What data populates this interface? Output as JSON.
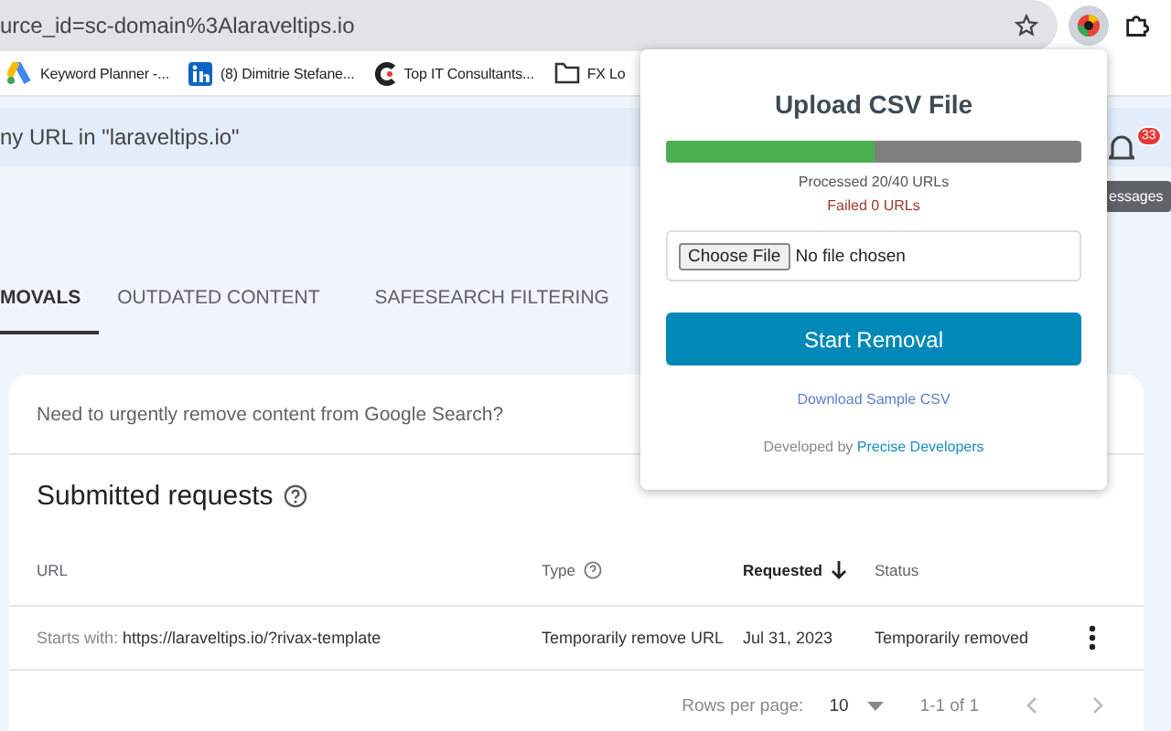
{
  "browser": {
    "address": "urce_id=sc-domain%3Alaraveltips.io",
    "bookmarks": [
      {
        "kind": "ads",
        "label": "Keyword Planner -..."
      },
      {
        "kind": "linkedin",
        "label": "(8) Dimitrie Stefane..."
      },
      {
        "kind": "c-logo",
        "label": "Top IT Consultants..."
      },
      {
        "kind": "folder",
        "label": "FX Lo"
      }
    ]
  },
  "page": {
    "search_text": "ny URL in \"laraveltips.io\"",
    "notification_count": "33",
    "tooltip": "essages",
    "tabs": [
      {
        "label": "MOVALS",
        "selected": true
      },
      {
        "label": "OUTDATED CONTENT",
        "selected": false
      },
      {
        "label": "SAFESEARCH FILTERING",
        "selected": false
      }
    ],
    "notice": "Need to urgently remove content from Google Search?",
    "section_title": "Submitted requests",
    "table": {
      "columns": [
        {
          "label": "URL",
          "help": false,
          "sorted": false
        },
        {
          "label": "Type",
          "help": true,
          "sorted": false
        },
        {
          "label": "Requested",
          "help": false,
          "sorted": true
        },
        {
          "label": "Status",
          "help": false,
          "sorted": false
        }
      ],
      "rows": [
        {
          "url_prefix": "Starts with:",
          "url": "https://laraveltips.io/?rivax-template",
          "type": "Temporarily remove URL",
          "requested": "Jul 31, 2023",
          "status": "Temporarily removed"
        }
      ]
    },
    "pagination": {
      "rows_label": "Rows per page:",
      "rows_value": "10",
      "range": "1-1 of 1"
    }
  },
  "popup": {
    "title": "Upload CSV File",
    "level": 0.5,
    "processed": "Processed 20/40 URLs",
    "failed": "Failed 0 URLs",
    "file_button": "Choose File",
    "file_status": "No file chosen",
    "submit": "Start Removal",
    "download_link": "Download Sample CSV",
    "credit_prefix": "Developed by",
    "credit_link": "Precise Developers"
  }
}
